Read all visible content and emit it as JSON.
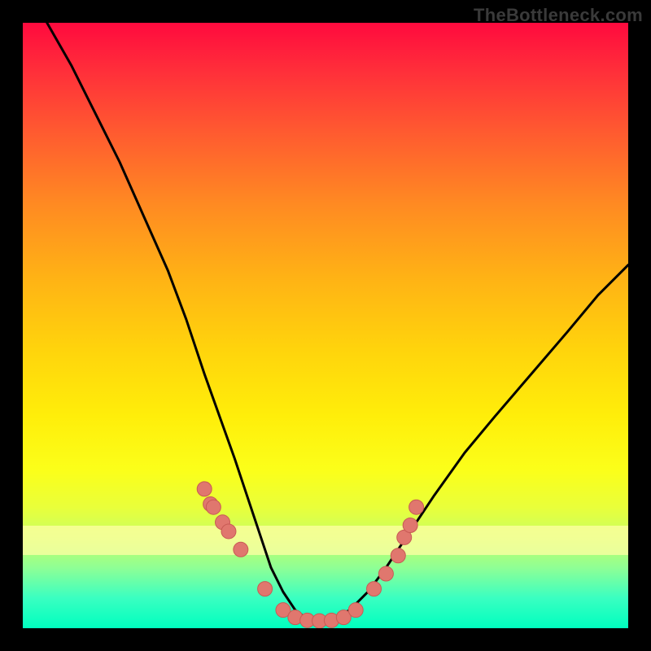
{
  "watermark": "TheBottleneck.com",
  "colors": {
    "frame": "#000000",
    "curve": "#000000",
    "marker_fill": "#e0776e",
    "marker_stroke": "#c85a54"
  },
  "chart_data": {
    "type": "line",
    "title": "",
    "xlabel": "",
    "ylabel": "",
    "xlim": [
      0,
      100
    ],
    "ylim": [
      0,
      100
    ],
    "grid": false,
    "legend": false,
    "series": [
      {
        "name": "bottleneck-curve",
        "x": [
          4,
          8,
          12,
          16,
          20,
          24,
          27,
          30,
          32.5,
          35,
          37,
          39,
          41,
          43,
          45,
          47,
          49,
          51,
          54,
          57,
          60,
          64,
          68,
          73,
          78,
          84,
          90,
          95,
          100
        ],
        "y": [
          100,
          93,
          85,
          77,
          68,
          59,
          51,
          42,
          35,
          28,
          22,
          16,
          10,
          6,
          3,
          1.5,
          1.2,
          1.5,
          3,
          6,
          10,
          16,
          22,
          29,
          35,
          42,
          49,
          55,
          60
        ]
      }
    ],
    "markers": {
      "name": "data-points",
      "x": [
        30,
        31,
        31.5,
        33,
        34,
        36,
        40,
        43,
        45,
        47,
        49,
        51,
        53,
        55,
        58,
        60,
        62,
        63,
        64,
        65
      ],
      "y": [
        23,
        20.5,
        20,
        17.5,
        16,
        13,
        6.5,
        3,
        1.8,
        1.3,
        1.2,
        1.3,
        1.8,
        3,
        6.5,
        9,
        12,
        15,
        17,
        20
      ]
    }
  }
}
